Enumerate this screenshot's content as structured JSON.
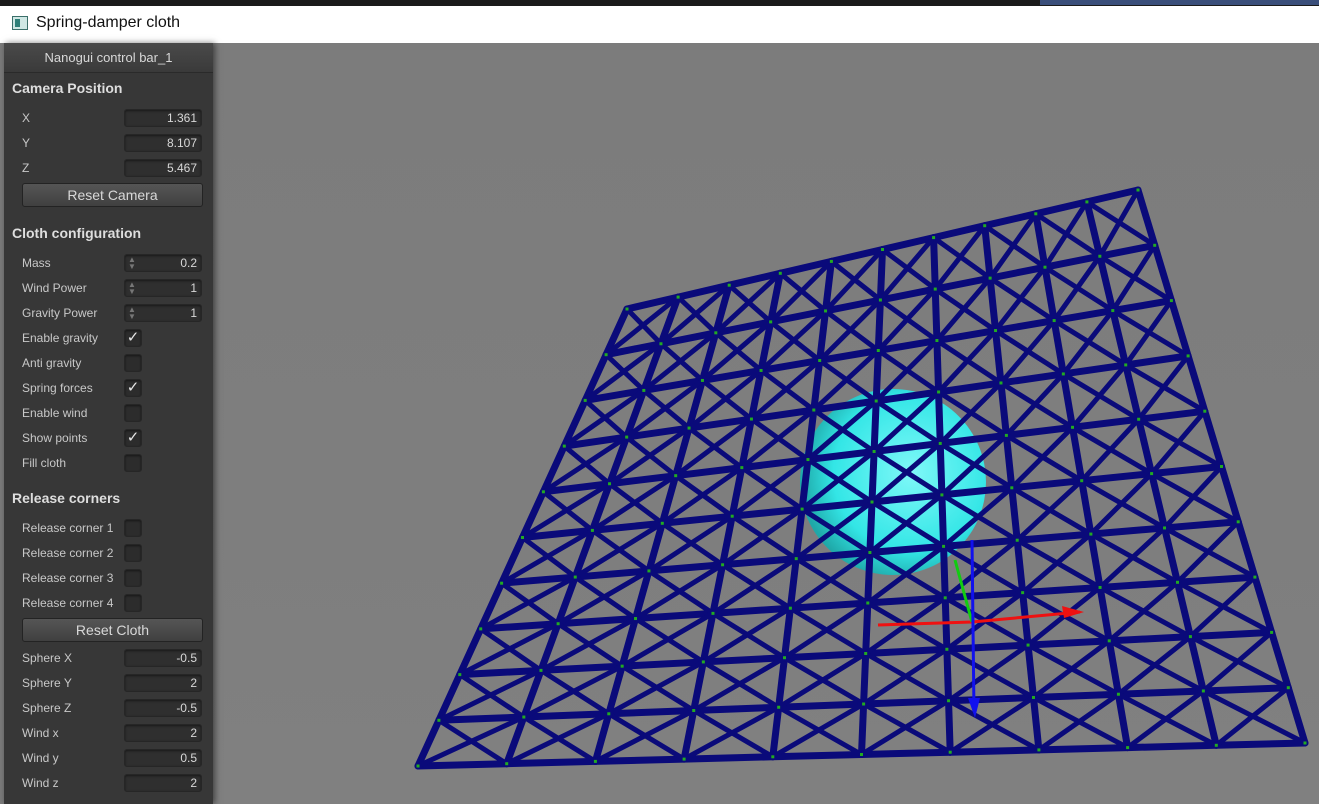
{
  "window": {
    "title": "Spring-damper cloth"
  },
  "panel": {
    "header": "Nanogui control bar_1",
    "camera": {
      "title": "Camera Position",
      "fields": [
        {
          "label": "X",
          "value": "1.361"
        },
        {
          "label": "Y",
          "value": "8.107"
        },
        {
          "label": "Z",
          "value": "5.467"
        }
      ],
      "reset_label": "Reset Camera"
    },
    "cloth": {
      "title": "Cloth configuration",
      "spinners": [
        {
          "label": "Mass",
          "value": "0.2"
        },
        {
          "label": "Wind Power",
          "value": "1"
        },
        {
          "label": "Gravity Power",
          "value": "1"
        }
      ],
      "checks": [
        {
          "label": "Enable gravity",
          "checked": true
        },
        {
          "label": "Anti gravity",
          "checked": false
        },
        {
          "label": "Spring forces",
          "checked": true
        },
        {
          "label": "Enable wind",
          "checked": false
        },
        {
          "label": "Show points",
          "checked": true
        },
        {
          "label": "Fill cloth",
          "checked": false
        }
      ]
    },
    "release": {
      "title": "Release corners",
      "checks": [
        {
          "label": "Release corner 1",
          "checked": false
        },
        {
          "label": "Release corner 2",
          "checked": false
        },
        {
          "label": "Release corner 3",
          "checked": false
        },
        {
          "label": "Release corner 4",
          "checked": false
        }
      ],
      "reset_label": "Reset Cloth"
    },
    "params": [
      {
        "label": "Sphere X",
        "value": "-0.5"
      },
      {
        "label": "Sphere Y",
        "value": "2"
      },
      {
        "label": "Sphere Z",
        "value": "-0.5"
      },
      {
        "label": "Wind x",
        "value": "2"
      },
      {
        "label": "Wind y",
        "value": "0.5"
      },
      {
        "label": "Wind z",
        "value": "2"
      }
    ]
  },
  "scene": {
    "cloth_color": "#0a0a7a",
    "sphere_color": "#33e6e6",
    "point_color": "#22aa22",
    "axis_colors": {
      "x": "#ee1111",
      "y": "#11cc11",
      "z": "#1111ee"
    }
  }
}
